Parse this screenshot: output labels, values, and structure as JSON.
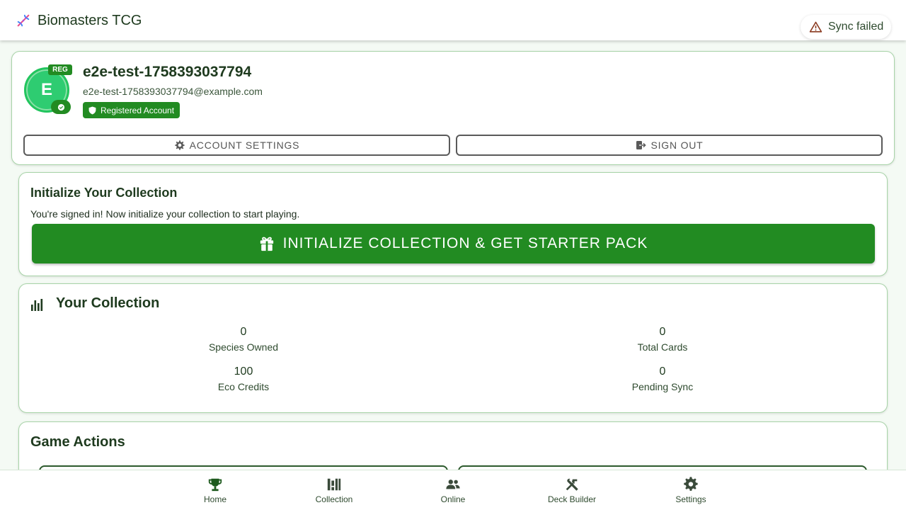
{
  "app": {
    "title": "Biomasters TCG",
    "sync_status": "Sync failed"
  },
  "profile": {
    "avatar_letter": "E",
    "reg_badge": "REG",
    "username": "e2e-test-1758393037794",
    "email": "e2e-test-1758393037794@example.com",
    "account_type": "Registered Account",
    "account_settings_label": "ACCOUNT SETTINGS",
    "sign_out_label": "SIGN OUT"
  },
  "init_collection": {
    "title": "Initialize Your Collection",
    "description": "You're signed in! Now initialize your collection to start playing.",
    "button_label": "INITIALIZE COLLECTION & GET STARTER PACK"
  },
  "collection": {
    "title": "Your Collection",
    "stats": [
      {
        "value": "0",
        "label": "Species Owned"
      },
      {
        "value": "0",
        "label": "Total Cards"
      },
      {
        "value": "100",
        "label": "Eco Credits"
      },
      {
        "value": "0",
        "label": "Pending Sync"
      }
    ]
  },
  "game_actions": {
    "title": "Game Actions"
  },
  "bottom_nav": {
    "items": [
      {
        "label": "Home",
        "icon": "trophy-icon"
      },
      {
        "label": "Collection",
        "icon": "library-icon"
      },
      {
        "label": "Online",
        "icon": "people-icon"
      },
      {
        "label": "Deck Builder",
        "icon": "tools-icon"
      },
      {
        "label": "Settings",
        "icon": "gear-icon"
      }
    ]
  },
  "colors": {
    "primary": "#228b22",
    "avatar": "#2ecc71",
    "text": "#1e3a1e",
    "card_border": "#a8d4a8",
    "warning": "#c0392b"
  }
}
